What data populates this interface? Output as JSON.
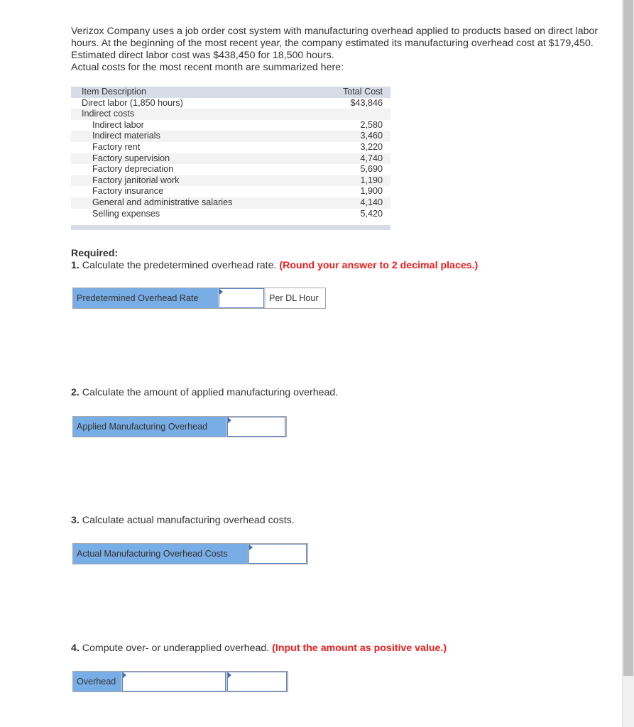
{
  "intro": {
    "paragraph": "Verizox Company uses a job order cost system with manufacturing overhead applied to products based on direct labor hours. At the beginning of the most recent year, the company estimated its manufacturing overhead cost at $179,450. Estimated direct labor cost was $438,450 for 18,500 hours.",
    "summary_line": "Actual costs for the most recent month are summarized here:"
  },
  "cost_table": {
    "headers": {
      "description": "Item Description",
      "total": "Total Cost"
    },
    "rows": [
      {
        "description": "Direct labor (1,850 hours)",
        "amount": "$43,846",
        "indent": false
      },
      {
        "description": "Indirect costs",
        "amount": "",
        "indent": false
      },
      {
        "description": "Indirect labor",
        "amount": "2,580",
        "indent": true
      },
      {
        "description": "Indirect materials",
        "amount": "3,460",
        "indent": true
      },
      {
        "description": "Factory rent",
        "amount": "3,220",
        "indent": true
      },
      {
        "description": "Factory supervision",
        "amount": "4,740",
        "indent": true
      },
      {
        "description": "Factory depreciation",
        "amount": "5,690",
        "indent": true
      },
      {
        "description": "Factory janitorial work",
        "amount": "1,190",
        "indent": true
      },
      {
        "description": "Factory insurance",
        "amount": "1,900",
        "indent": true
      },
      {
        "description": "General and administrative salaries",
        "amount": "4,140",
        "indent": true
      },
      {
        "description": "Selling expenses",
        "amount": "5,420",
        "indent": true
      }
    ]
  },
  "required": {
    "title": "Required:",
    "questions": [
      {
        "number": "1.",
        "text": " Calculate the predetermined overhead rate. ",
        "note": "(Round your answer to 2 decimal places.)",
        "answer_label": "Predetermined Overhead Rate",
        "value": "",
        "unit": "Per DL Hour"
      },
      {
        "number": "2.",
        "text": " Calculate the amount of applied manufacturing overhead.",
        "note": "",
        "answer_label": "Applied Manufacturing Overhead",
        "value": ""
      },
      {
        "number": "3.",
        "text": " Calculate actual manufacturing overhead costs.",
        "note": "",
        "answer_label": "Actual Manufacturing Overhead Costs",
        "value": ""
      },
      {
        "number": "4.",
        "text": " Compute over- or underapplied overhead. ",
        "note": "(Input the amount as positive value.)",
        "answer_label": "Overhead",
        "value_amount": "",
        "value_type": ""
      }
    ]
  },
  "colors": {
    "label_fill": "#79ade5",
    "note_red": "#ee1d1d",
    "table_header": "#d7dce7",
    "input_border": "#5a84c4"
  }
}
